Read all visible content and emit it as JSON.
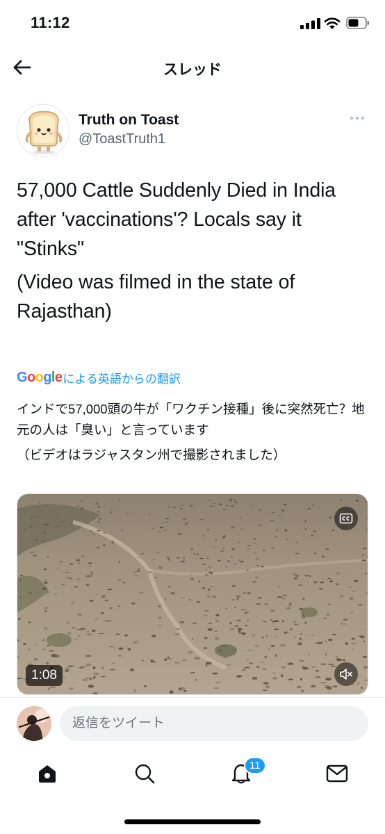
{
  "status_bar": {
    "time": "11:12"
  },
  "header": {
    "title": "スレッド"
  },
  "tweet": {
    "author_name": "Truth on Toast",
    "author_handle": "@ToastTruth1",
    "text_paragraphs": [
      "57,000 Cattle Suddenly Died in India after 'vaccinations'? Locals say it \"Stinks\"",
      "(Video was filmed in the state of Rajasthan)"
    ],
    "translation_logo": "Google",
    "translation_label": "による英語からの翻訳",
    "translated_paragraphs": [
      "インドで57,000頭の牛が「ワクチン接種」後に突然死亡？地元の人は「臭い」と言っています",
      "（ビデオはラジャスタン州で撮影されました）"
    ],
    "video": {
      "duration": "1:08"
    }
  },
  "reply": {
    "placeholder": "返信をツイート"
  },
  "tabs": {
    "notifications_badge": "11"
  },
  "colors": {
    "accent": "#1d9bf0",
    "text": "#0f1419",
    "secondary": "#536471"
  },
  "icons": [
    "arrow-left-icon",
    "more-icon",
    "captions-icon",
    "mute-icon",
    "home-icon",
    "search-icon",
    "bell-icon",
    "mail-icon"
  ]
}
